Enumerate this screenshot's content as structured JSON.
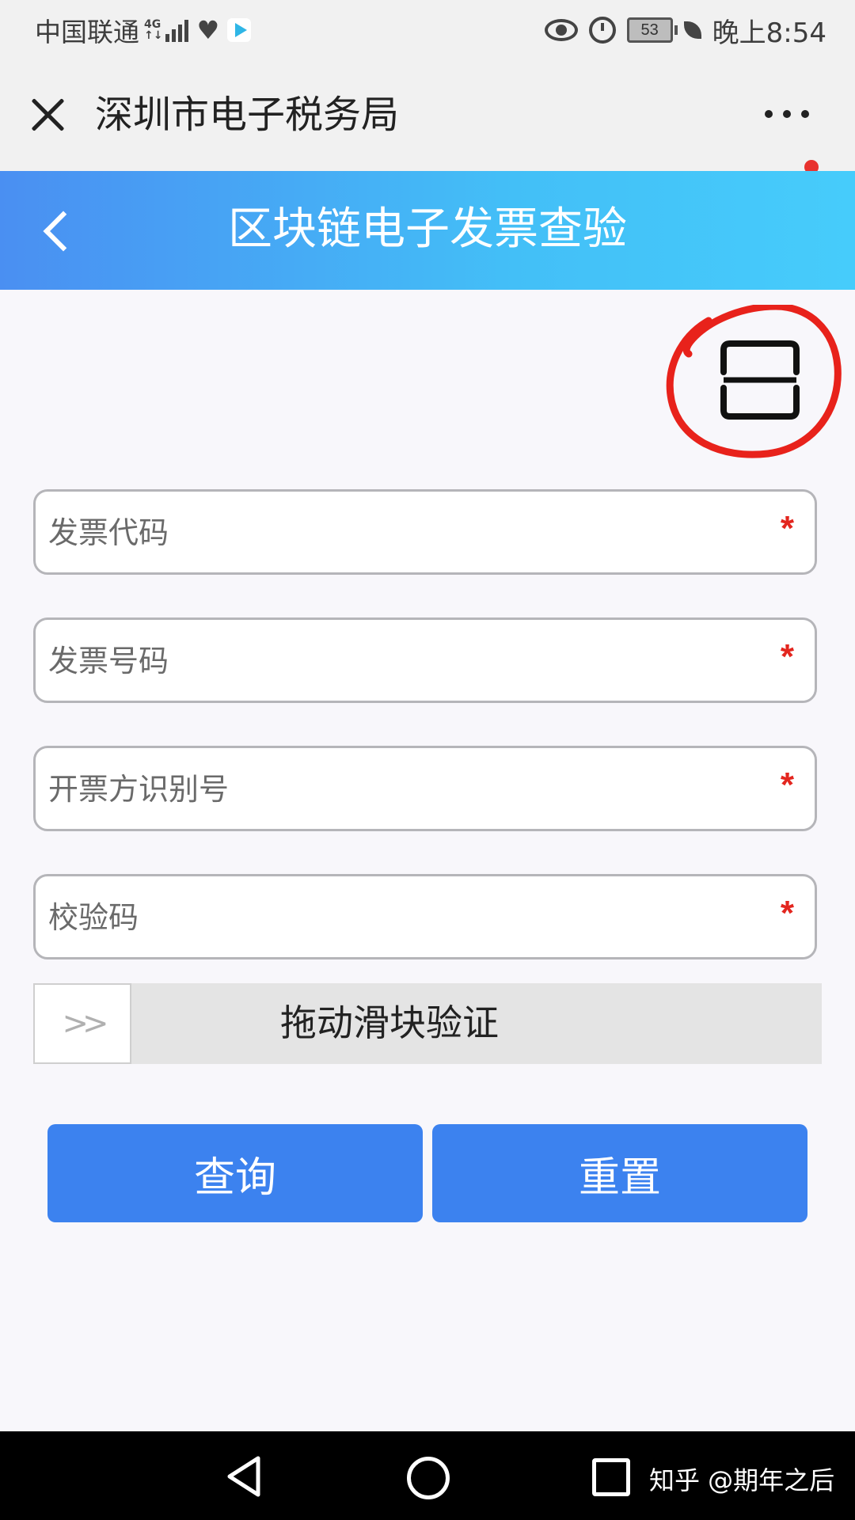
{
  "status_bar": {
    "carrier": "中国联通",
    "network": "4G",
    "time": "晚上8:54",
    "battery_level": "53",
    "icons": [
      "signal-icon",
      "heart-icon",
      "play-icon",
      "eye-icon",
      "alarm-icon",
      "battery-icon",
      "leaf-icon"
    ]
  },
  "app_bar": {
    "title": "深圳市电子税务局",
    "icons": [
      "close-icon",
      "more-icon"
    ],
    "notification_dot_color": "#e8322e"
  },
  "page_header": {
    "title": "区块链电子发票查验",
    "gradient_start": "#4a8ff2",
    "gradient_end": "#46ccfb",
    "icons": [
      "back-icon"
    ]
  },
  "scan": {
    "icon": "scan-icon",
    "annotation_color": "#e8221b"
  },
  "form": {
    "fields": [
      {
        "placeholder": "发票代码",
        "required_mark": "*"
      },
      {
        "placeholder": "发票号码",
        "required_mark": "*"
      },
      {
        "placeholder": "开票方识别号",
        "required_mark": "*"
      },
      {
        "placeholder": "校验码",
        "required_mark": "*"
      }
    ],
    "slider": {
      "handle_label": ">>",
      "label": "拖动滑块验证"
    },
    "buttons": {
      "query": "查询",
      "reset": "重置",
      "color": "#3c82ef"
    }
  },
  "nav_bar": {
    "icons": [
      "nav-back-icon",
      "nav-home-icon",
      "nav-recent-icon"
    ]
  },
  "watermark": "知乎 @期年之后"
}
